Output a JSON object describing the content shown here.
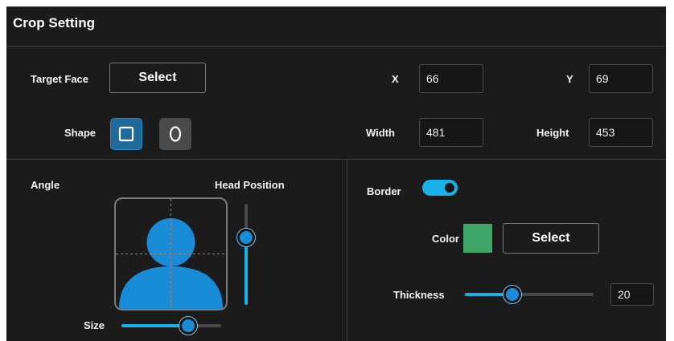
{
  "panel": {
    "title": "Crop Setting"
  },
  "target_face": {
    "label": "Target Face",
    "button": "Select"
  },
  "shape": {
    "label": "Shape",
    "options": [
      "square",
      "ellipse"
    ],
    "selected": "square"
  },
  "coords": {
    "x_label": "X",
    "x_value": "66",
    "y_label": "Y",
    "y_value": "69",
    "width_label": "Width",
    "width_value": "481",
    "height_label": "Height",
    "height_value": "453"
  },
  "angle": {
    "label": "Angle",
    "head_position_label": "Head Position",
    "head_position_level": 0.67,
    "size_label": "Size",
    "size_level": 0.67
  },
  "border": {
    "label": "Border",
    "enabled": true,
    "color_label": "Color",
    "color": "#3fa568",
    "color_button": "Select",
    "thickness_label": "Thickness",
    "thickness_level": 0.37,
    "thickness_value": "20"
  },
  "colors": {
    "accent": "#1ab0e8",
    "panel": "#1b1b1b",
    "figure": "#1a8bd6"
  }
}
